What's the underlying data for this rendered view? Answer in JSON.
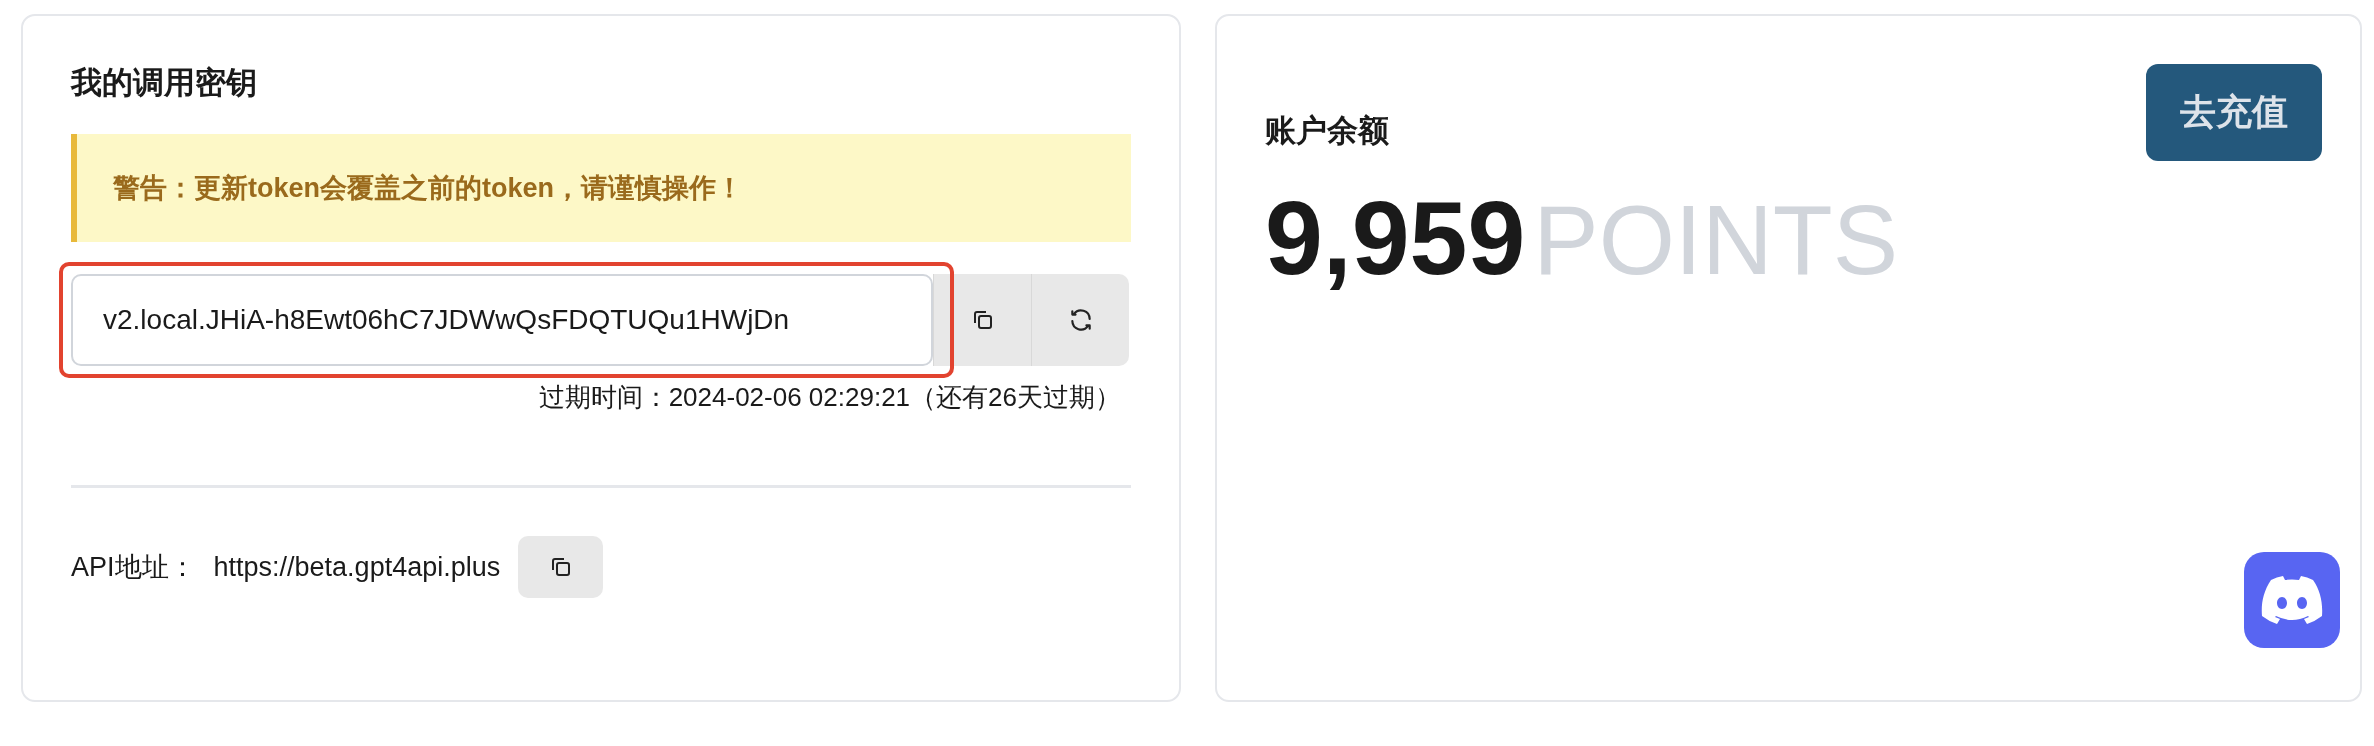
{
  "key_card": {
    "title": "我的调用密钥",
    "warning": "警告：更新token会覆盖之前的token，请谨慎操作！",
    "token_field": {
      "value": "v2.local.JHiA-h8Ewt06hC7JDWwQsFDQTUQu1HWjDn",
      "highlighted": true
    },
    "expiry": "过期时间：2024-02-06 02:29:21（还有26天过期）",
    "api_label": "API地址：",
    "api_url": "https://beta.gpt4api.plus"
  },
  "balance_card": {
    "title": "账户余额",
    "recharge_button": "去充值",
    "amount": "9,959",
    "unit": "POINTS"
  }
}
